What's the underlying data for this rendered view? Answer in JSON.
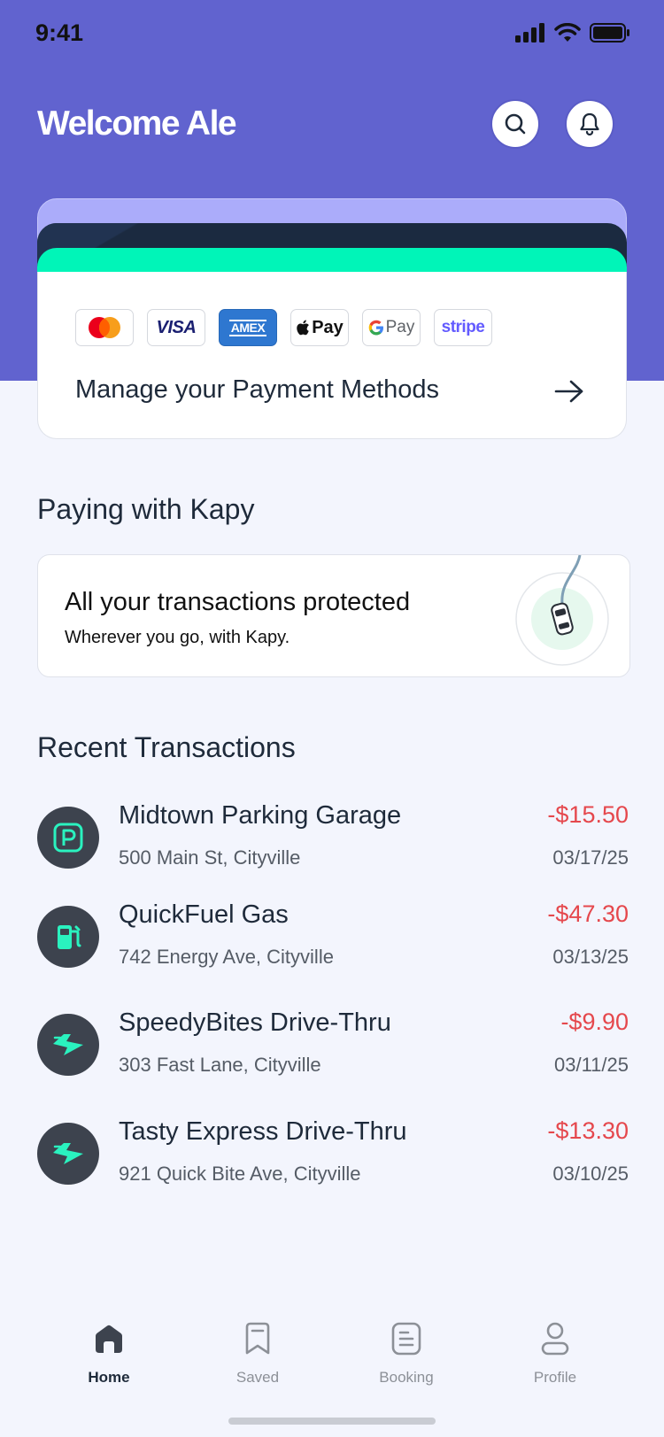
{
  "status_bar": {
    "time": "9:41",
    "icons": [
      "signal-icon",
      "wifi-icon",
      "battery-icon"
    ]
  },
  "header": {
    "greeting": "Welcome Ale",
    "search_icon": "search-icon",
    "bell_icon": "bell-icon"
  },
  "payment_card": {
    "logos": [
      "Mastercard",
      "VISA",
      "AMEX",
      "Apple Pay",
      "G Pay",
      "stripe"
    ],
    "visa_text": "VISA",
    "amex_text": "AMEX",
    "apple_pay_text": "Pay",
    "gpay_text": "Pay",
    "stripe_text": "stripe",
    "manage_label": "Manage your Payment Methods",
    "arrow_icon": "arrow-right-icon"
  },
  "paying_section": {
    "title": "Paying with Kapy",
    "card_title": "All your transactions protected",
    "card_subtitle": "Wherever you go, with Kapy."
  },
  "recent_section": {
    "title": "Recent Transactions",
    "transactions": [
      {
        "name": "Midtown Parking Garage",
        "address": "500 Main St, Cityville",
        "amount": "-$15.50",
        "date": "03/17/25",
        "icon": "parking-icon"
      },
      {
        "name": "QuickFuel Gas",
        "address": "742 Energy Ave, Cityville",
        "amount": "-$47.30",
        "date": "03/13/25",
        "icon": "gas-pump-icon"
      },
      {
        "name": "SpeedyBites Drive-Thru",
        "address": "303 Fast Lane, Cityville",
        "amount": "-$9.90",
        "date": "03/11/25",
        "icon": "drive-thru-icon"
      },
      {
        "name": "Tasty Express Drive-Thru",
        "address": "921 Quick Bite Ave, Cityville",
        "amount": "-$13.30",
        "date": "03/10/25",
        "icon": "drive-thru-icon"
      }
    ]
  },
  "tab_bar": {
    "tabs": [
      {
        "label": "Home",
        "icon": "home-icon",
        "active": true
      },
      {
        "label": "Saved",
        "icon": "bookmark-icon",
        "active": false
      },
      {
        "label": "Booking",
        "icon": "booking-icon",
        "active": false
      },
      {
        "label": "Profile",
        "icon": "profile-icon",
        "active": false
      }
    ]
  },
  "colors": {
    "brand": "#6163CF",
    "accent": "#00F5B8",
    "negative": "#E5484D",
    "dark_card": "#1B2A40"
  }
}
